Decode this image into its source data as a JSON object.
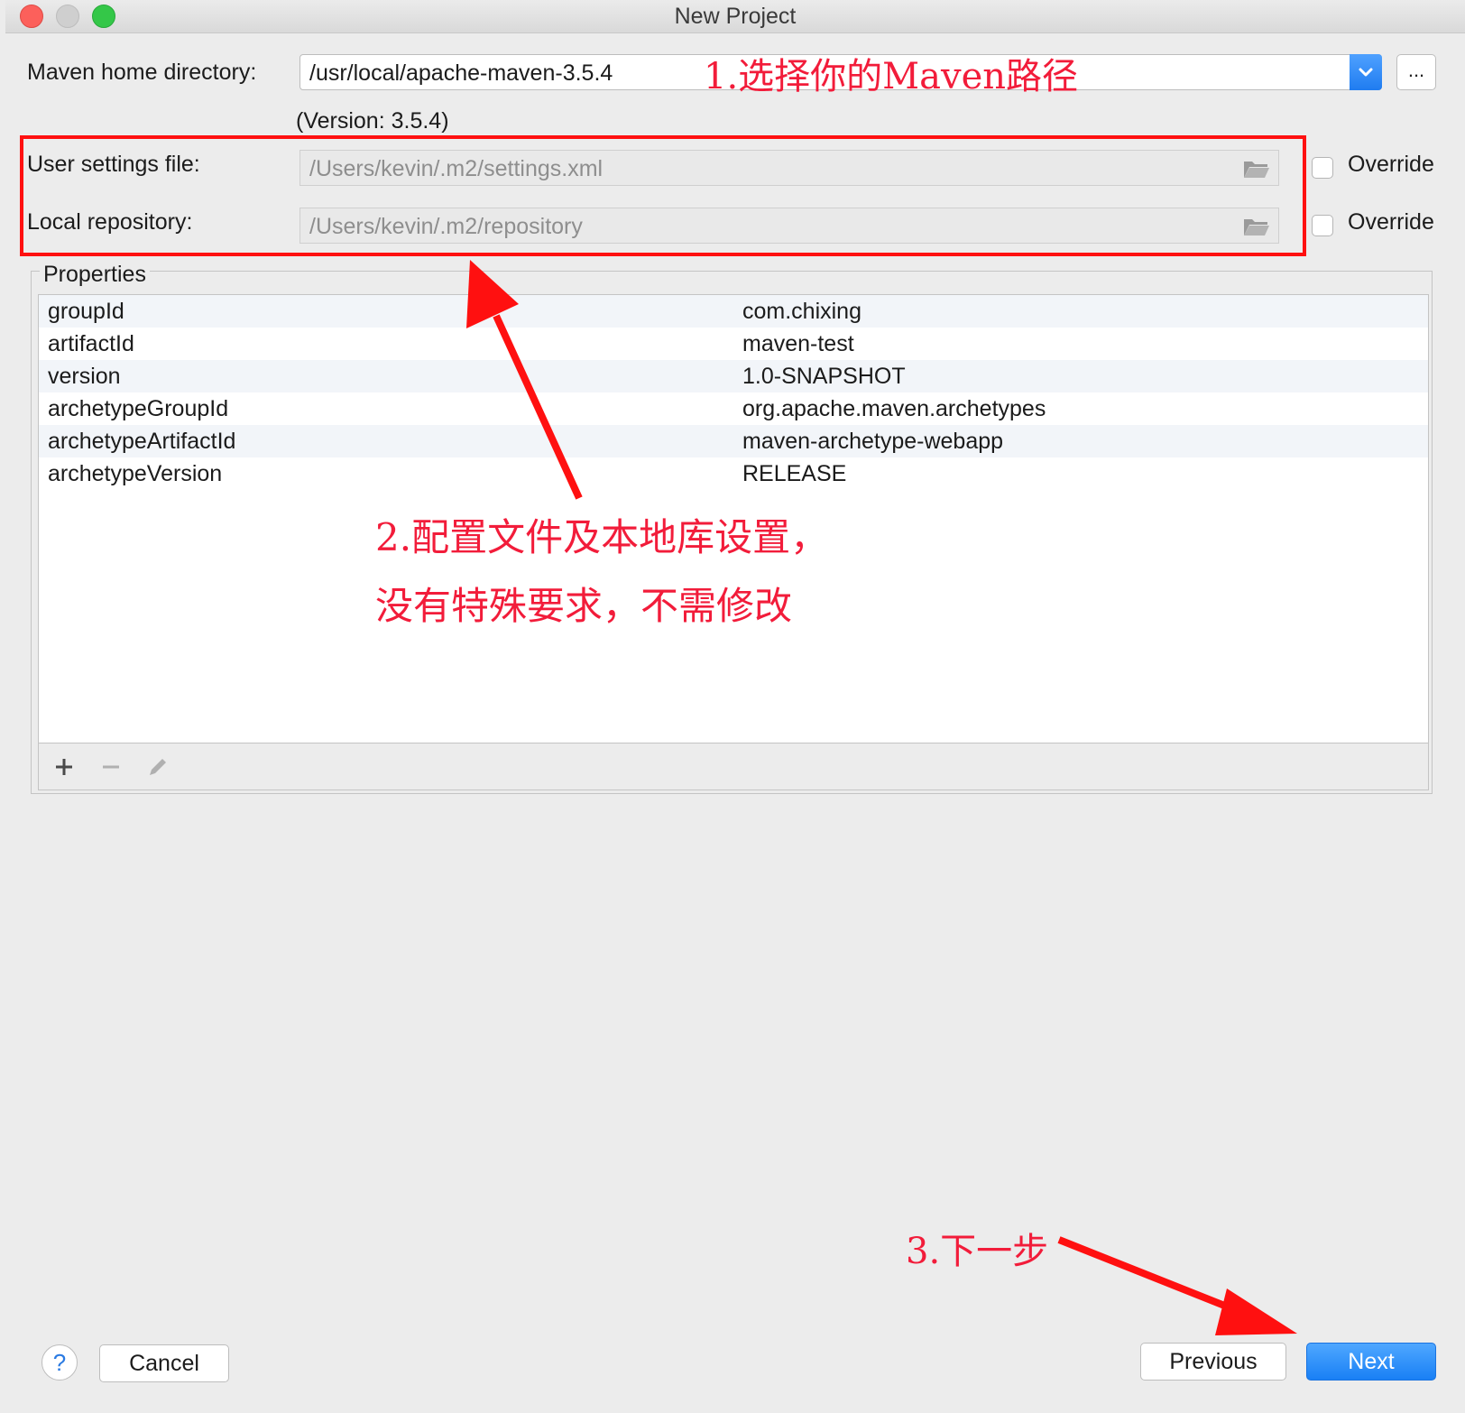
{
  "window": {
    "title": "New Project"
  },
  "form": {
    "maven_home_label": "Maven home directory:",
    "maven_home_value": "/usr/local/apache-maven-3.5.4",
    "maven_version": "(Version: 3.5.4)",
    "browse_label": "...",
    "user_settings_label": "User settings file:",
    "user_settings_value": "/Users/kevin/.m2/settings.xml",
    "local_repo_label": "Local repository:",
    "local_repo_value": "/Users/kevin/.m2/repository",
    "override_label": "Override"
  },
  "properties": {
    "title": "Properties",
    "rows": [
      {
        "key": "groupId",
        "value": "com.chixing"
      },
      {
        "key": "artifactId",
        "value": "maven-test"
      },
      {
        "key": "version",
        "value": "1.0-SNAPSHOT"
      },
      {
        "key": "archetypeGroupId",
        "value": "org.apache.maven.archetypes"
      },
      {
        "key": "archetypeArtifactId",
        "value": "maven-archetype-webapp"
      },
      {
        "key": "archetypeVersion",
        "value": "RELEASE"
      }
    ],
    "toolbar_icons": [
      "add-icon",
      "remove-icon",
      "edit-icon"
    ]
  },
  "annotations": {
    "step1": "1.选择你的Maven路径",
    "step2_line1": "2.配置文件及本地库设置，",
    "step2_line2": "没有特殊要求，不需修改",
    "step3": "3.下一步",
    "color": "#f21c3a"
  },
  "footer": {
    "help_label": "?",
    "cancel_label": "Cancel",
    "previous_label": "Previous",
    "next_label": "Next"
  },
  "colors": {
    "accent": "#1f7cf0",
    "annotation_red": "#ff1010"
  }
}
